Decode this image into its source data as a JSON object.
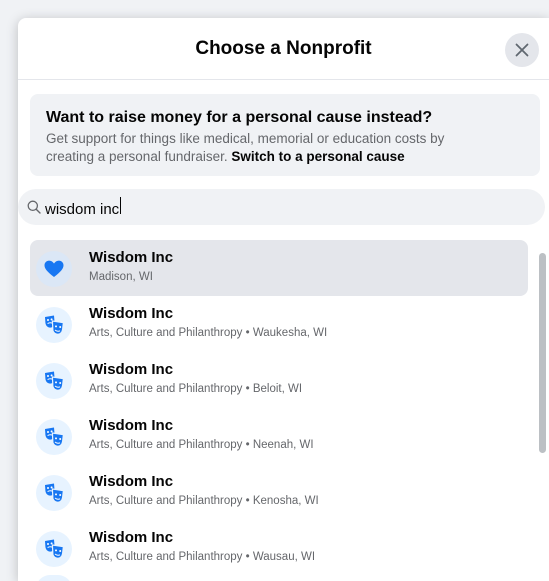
{
  "dialog": {
    "title": "Choose a Nonprofit",
    "close_icon": "close-icon"
  },
  "banner": {
    "title": "Want to raise money for a personal cause instead?",
    "body_line1": "Get support for things like medical, memorial or education costs by",
    "body_line2": "creating a personal fundraiser. ",
    "link": "Switch to a personal cause"
  },
  "search": {
    "icon": "search-icon",
    "value": "wisdom inc",
    "placeholder": "Search"
  },
  "results": [
    {
      "name": "Wisdom Inc",
      "subtitle": "Madison, WI",
      "icon": "heart-icon",
      "selected": true
    },
    {
      "name": "Wisdom Inc",
      "subtitle": "Arts, Culture and Philanthropy • Waukesha, WI",
      "icon": "theater-masks-icon",
      "selected": false
    },
    {
      "name": "Wisdom Inc",
      "subtitle": "Arts, Culture and Philanthropy • Beloit, WI",
      "icon": "theater-masks-icon",
      "selected": false
    },
    {
      "name": "Wisdom Inc",
      "subtitle": "Arts, Culture and Philanthropy • Neenah, WI",
      "icon": "theater-masks-icon",
      "selected": false
    },
    {
      "name": "Wisdom Inc",
      "subtitle": "Arts, Culture and Philanthropy • Kenosha, WI",
      "icon": "theater-masks-icon",
      "selected": false
    },
    {
      "name": "Wisdom Inc",
      "subtitle": "Arts, Culture and Philanthropy • Wausau, WI",
      "icon": "theater-masks-icon",
      "selected": false
    }
  ],
  "colors": {
    "accent_blue": "#1877f2",
    "icon_bg": "#e7f3ff",
    "selected_row": "#e4e6eb",
    "secondary_text": "#65676b"
  }
}
